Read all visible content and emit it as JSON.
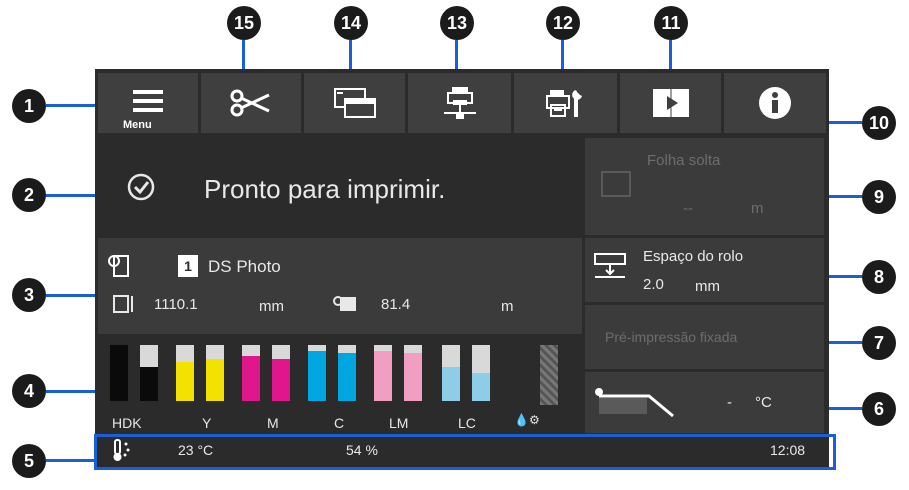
{
  "callouts": [
    "1",
    "2",
    "3",
    "4",
    "5",
    "6",
    "7",
    "8",
    "9",
    "10",
    "11",
    "12",
    "13",
    "14",
    "15"
  ],
  "toolbar": {
    "menu_label": "Menu",
    "buttons": [
      "menu-icon",
      "cut-icon",
      "media-settings-icon",
      "network-icon",
      "maintenance-icon",
      "video-manual-icon",
      "info-icon"
    ]
  },
  "status": {
    "message": "Pronto para imprimir."
  },
  "media": {
    "slot": "1",
    "name": "DS Photo",
    "length_value": "1110.1",
    "length_unit": "mm",
    "remaining_value": "81.4",
    "remaining_unit": "m"
  },
  "panel9": {
    "title": "Folha solta",
    "value": "--",
    "unit": "m"
  },
  "roll_space": {
    "title": "Espaço do rolo",
    "value": "2.0",
    "unit": "mm"
  },
  "panel7": {
    "title": "Pré-impressão fixada"
  },
  "heater": {
    "value": "-",
    "unit": "°C"
  },
  "inks": {
    "labels": [
      "HDK",
      "Y",
      "M",
      "C",
      "LM",
      "LC"
    ],
    "maintenance_icons": "💧⚙",
    "levels": [
      1.0,
      0.6,
      0.7,
      0.75,
      0.8,
      0.75,
      0.9,
      0.85,
      0.9,
      0.85,
      0.6,
      0.5
    ],
    "colors": [
      "#0a0a0a",
      "#0a0a0a",
      "#f3e200",
      "#f3e200",
      "#e0168c",
      "#e0168c",
      "#00a6e0",
      "#00a6e0",
      "#f19ec2",
      "#f19ec2",
      "#8ecde8",
      "#8ecde8"
    ]
  },
  "statusbar": {
    "temperature": "23 °C",
    "humidity": "54 %",
    "time": "12:08"
  }
}
